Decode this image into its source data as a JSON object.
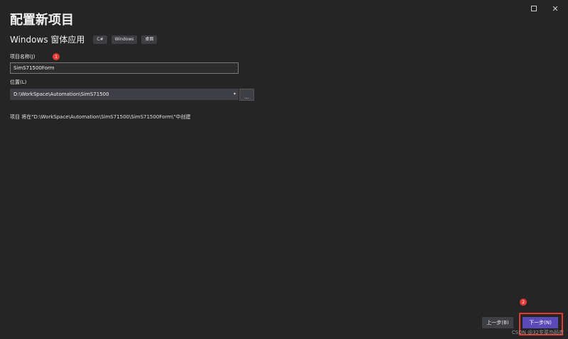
{
  "window": {
    "title": "配置新项目",
    "maximize_icon": "maximize-icon",
    "close_icon": "close-icon"
  },
  "template": {
    "name": "Windows 窗体应用",
    "tags": [
      "C#",
      "Windows",
      "桌面"
    ]
  },
  "project_name": {
    "label": "项目名称(J)",
    "value": "SimS71500Form"
  },
  "location": {
    "label": "位置(L)",
    "value": "D:\\WorkSpace\\Automation\\SimS71500",
    "browse_label": "..."
  },
  "info": {
    "text": "项目 将在\"D:\\WorkSpace\\Automation\\SimS71500\\SimS71500Form\\\"中创建"
  },
  "annotations": [
    {
      "number": "1"
    },
    {
      "number": "2"
    }
  ],
  "footer": {
    "back_label": "上一步(B)",
    "next_label": "下一步(N)"
  },
  "watermark": "CSDN @32岁菜鸟码农",
  "colors": {
    "accent": "#5b4ab8",
    "background": "#252526",
    "highlight": "#e53935"
  }
}
